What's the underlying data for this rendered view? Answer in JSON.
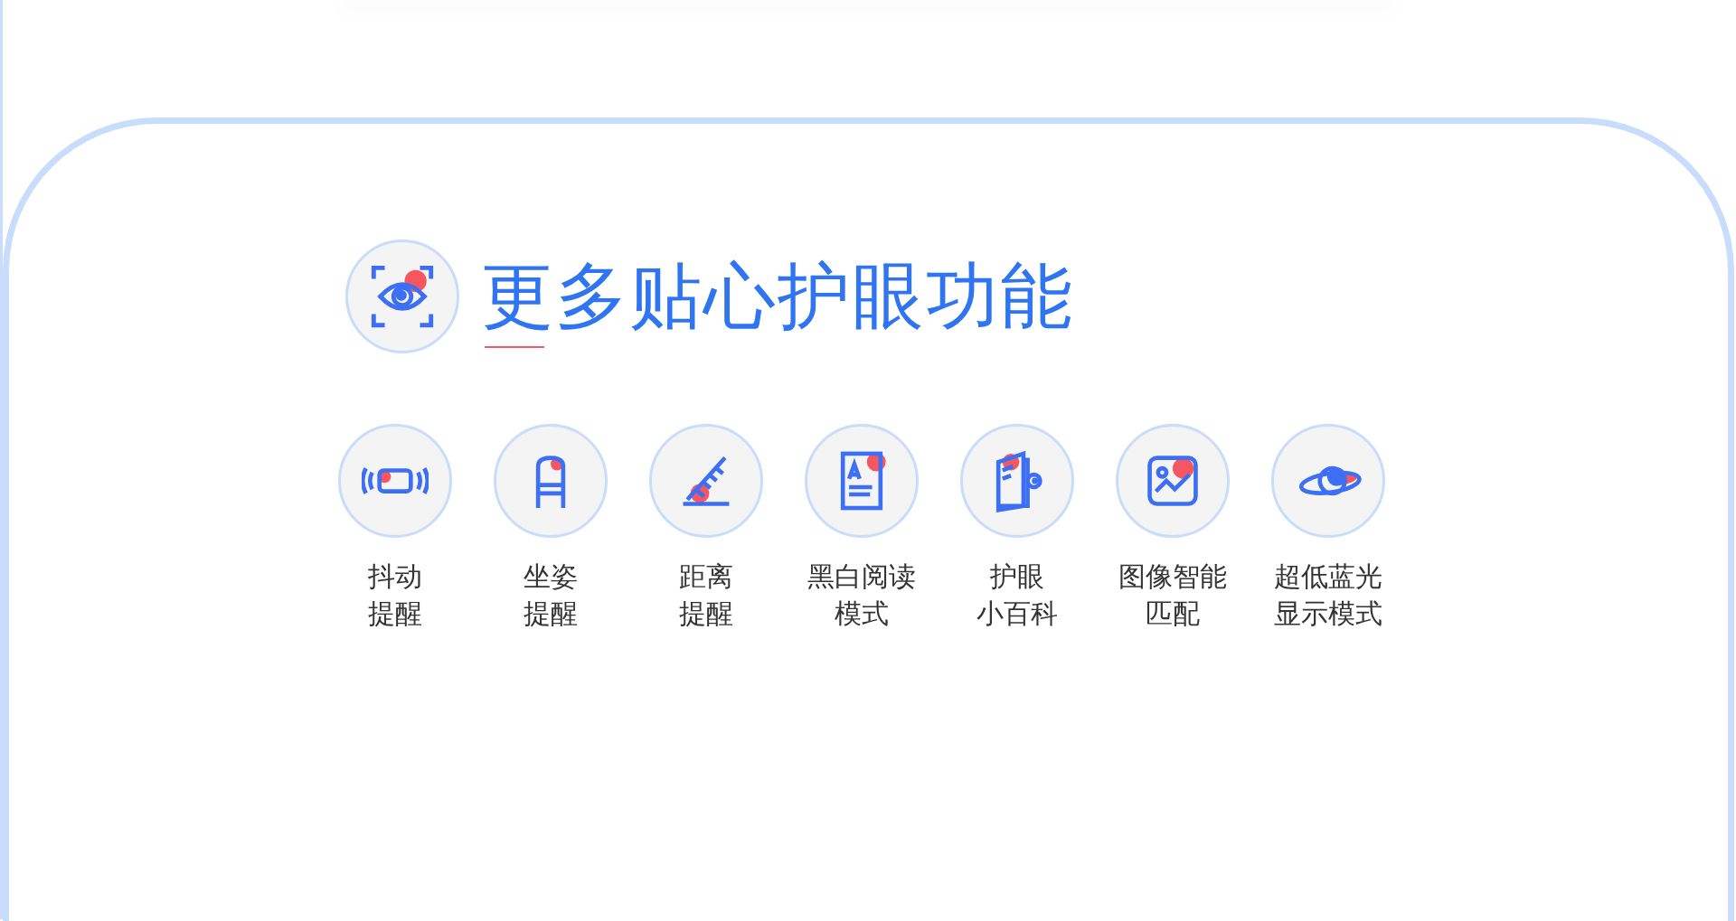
{
  "section": {
    "title": "更多贴心护眼功能",
    "features": [
      {
        "lines": [
          "抖动",
          "提醒"
        ]
      },
      {
        "lines": [
          "坐姿",
          "提醒"
        ]
      },
      {
        "lines": [
          "距离",
          "提醒"
        ]
      },
      {
        "lines": [
          "黑白阅读",
          "模式"
        ]
      },
      {
        "lines": [
          "护眼",
          "小百科"
        ]
      },
      {
        "lines": [
          "图像智能",
          "匹配"
        ]
      },
      {
        "lines": [
          "超低蓝光",
          "显示模式"
        ]
      }
    ]
  }
}
